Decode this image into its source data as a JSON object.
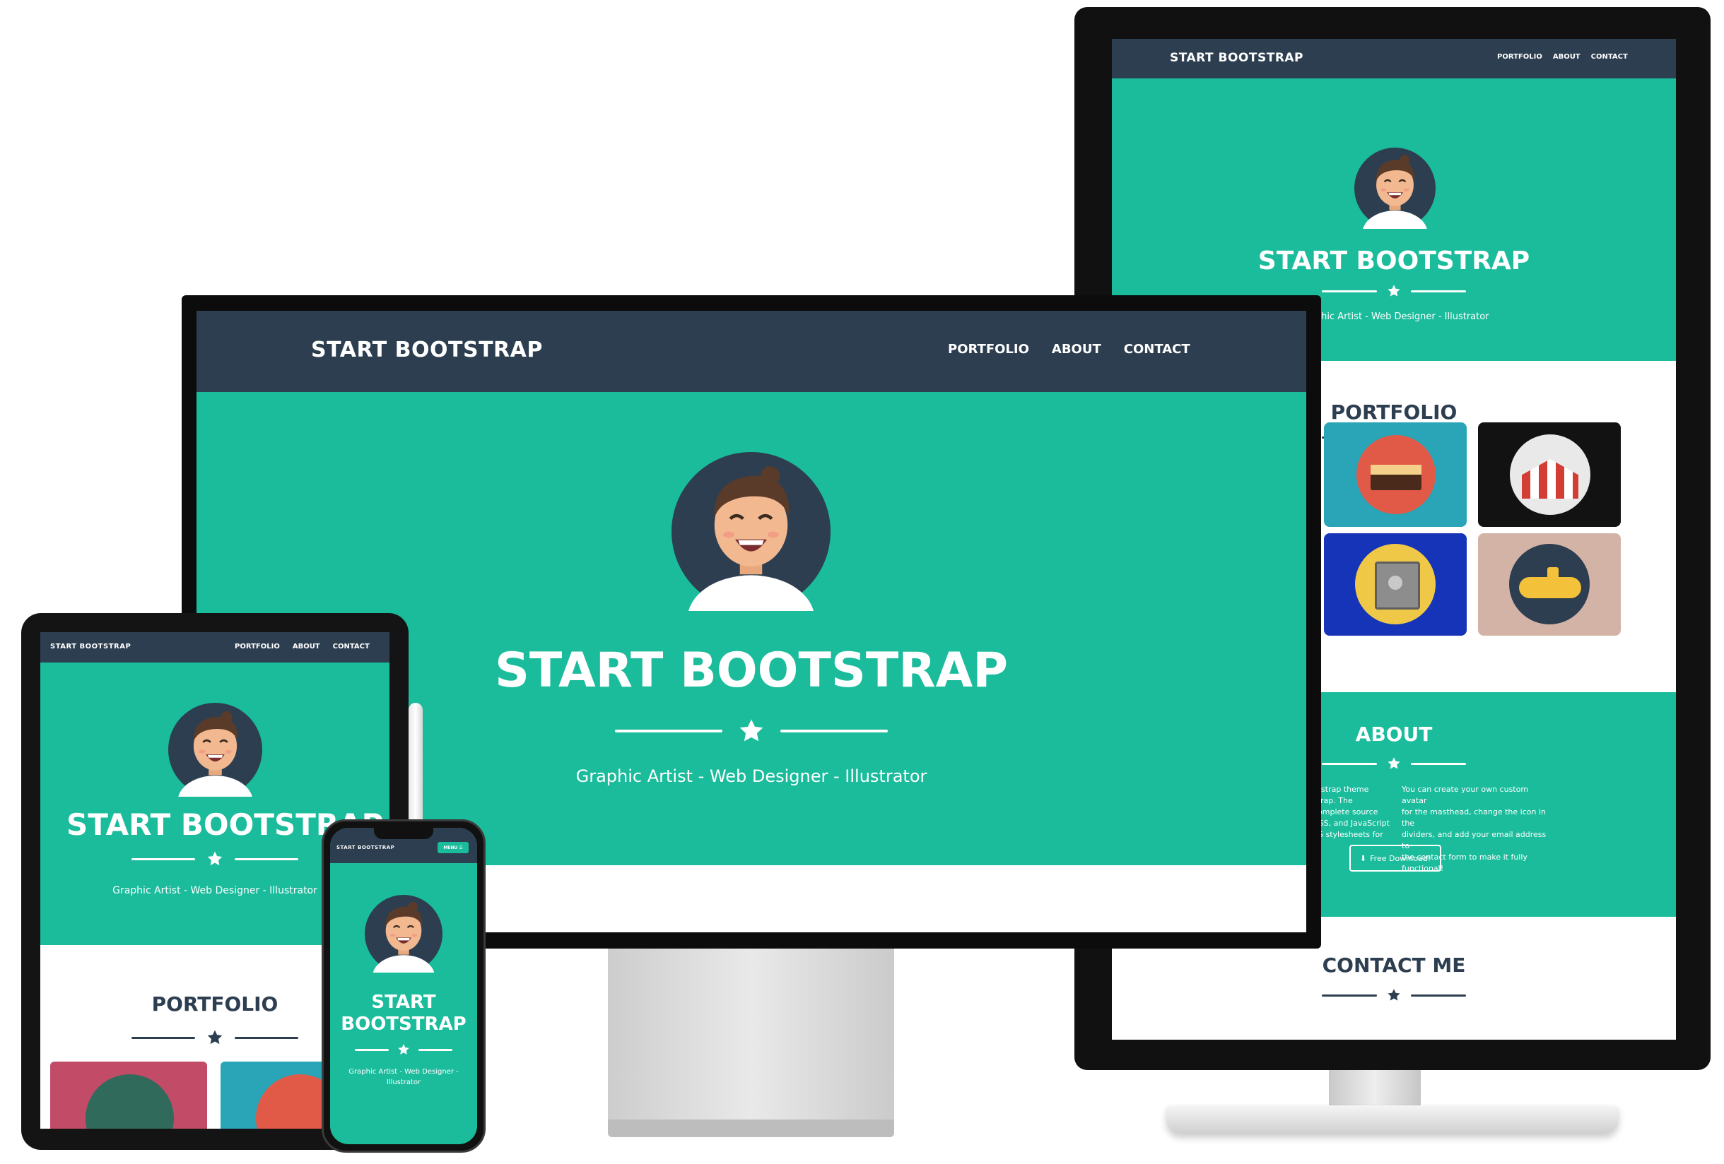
{
  "brand": "START BOOTSTRAP",
  "nav": {
    "portfolio": "PORTFOLIO",
    "about": "ABOUT",
    "contact": "CONTACT",
    "menu": "MENU"
  },
  "hero": {
    "title": "START BOOTSTRAP",
    "title_line1": "START",
    "title_line2": "BOOTSTRAP",
    "subtitle": "Graphic Artist - Web Designer - Illustrator",
    "subtitle_line1": "Graphic Artist - Web Designer -",
    "subtitle_line2": "Illustrator"
  },
  "sections": {
    "portfolio": "PORTFOLIO",
    "about": "ABOUT",
    "contact": "CONTACT ME"
  },
  "about": {
    "col1": [
      "otstrap theme",
      "strap. The",
      "complete source",
      "CSS, and JavaScript",
      "SS stylesheets for"
    ],
    "col2": [
      "You can create your own custom avatar",
      "for the masthead, change the icon in the",
      "dividers, and add your email address to",
      "the contact form to make it fully",
      "functional!"
    ],
    "download": "Free Download!"
  },
  "colors": {
    "teal": "#1abc9c",
    "navy": "#2c3e50",
    "white": "#ffffff"
  },
  "icons": {
    "star": "star-icon",
    "avatar": "avatar-icon",
    "menu": "hamburger-icon",
    "download": "download-icon"
  }
}
